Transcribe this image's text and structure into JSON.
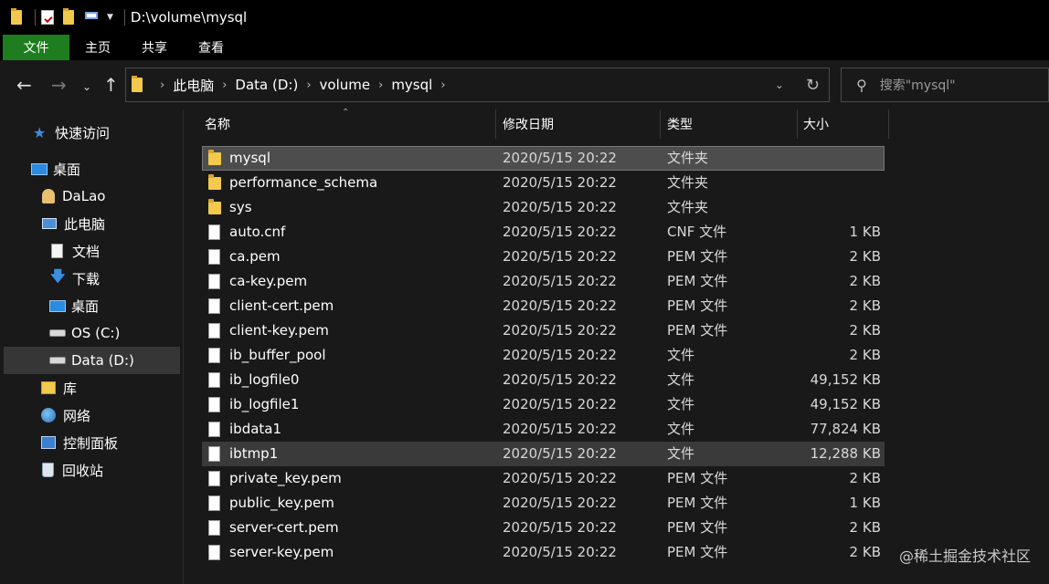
{
  "window": {
    "title": "D:\\volume\\mysql"
  },
  "ribbon": {
    "tabs": [
      {
        "label": "文件",
        "active": true
      },
      {
        "label": "主页",
        "active": false
      },
      {
        "label": "共享",
        "active": false
      },
      {
        "label": "查看",
        "active": false
      }
    ]
  },
  "nav": {
    "back_icon": "back-arrow",
    "forward_icon": "forward-arrow",
    "recent_icon": "chevron-down",
    "up_icon": "up-arrow"
  },
  "address": {
    "crumbs": [
      "此电脑",
      "Data (D:)",
      "volume",
      "mysql"
    ]
  },
  "search": {
    "placeholder": "搜索\"mysql\""
  },
  "sidebar": {
    "items": [
      {
        "label": "快速访问",
        "icon": "star-icon"
      },
      {
        "label": "桌面",
        "icon": "desktop-icon"
      },
      {
        "label": "DaLao",
        "icon": "user-folder-icon"
      },
      {
        "label": "此电脑",
        "icon": "computer-icon"
      },
      {
        "label": "文档",
        "icon": "document-icon"
      },
      {
        "label": "下载",
        "icon": "download-icon"
      },
      {
        "label": "桌面",
        "icon": "desktop-icon"
      },
      {
        "label": "OS (C:)",
        "icon": "drive-icon"
      },
      {
        "label": "Data (D:)",
        "icon": "drive-icon",
        "selected": true
      },
      {
        "label": "库",
        "icon": "library-icon"
      },
      {
        "label": "网络",
        "icon": "network-icon"
      },
      {
        "label": "控制面板",
        "icon": "control-panel-icon"
      },
      {
        "label": "回收站",
        "icon": "recycle-bin-icon"
      }
    ]
  },
  "columns": {
    "name": "名称",
    "date": "修改日期",
    "type": "类型",
    "size": "大小"
  },
  "files": [
    {
      "name": "mysql",
      "date": "2020/5/15 20:22",
      "type": "文件夹",
      "size": "",
      "kind": "folder",
      "state": "selected"
    },
    {
      "name": "performance_schema",
      "date": "2020/5/15 20:22",
      "type": "文件夹",
      "size": "",
      "kind": "folder"
    },
    {
      "name": "sys",
      "date": "2020/5/15 20:22",
      "type": "文件夹",
      "size": "",
      "kind": "folder"
    },
    {
      "name": "auto.cnf",
      "date": "2020/5/15 20:22",
      "type": "CNF 文件",
      "size": "1 KB",
      "kind": "file"
    },
    {
      "name": "ca.pem",
      "date": "2020/5/15 20:22",
      "type": "PEM 文件",
      "size": "2 KB",
      "kind": "file"
    },
    {
      "name": "ca-key.pem",
      "date": "2020/5/15 20:22",
      "type": "PEM 文件",
      "size": "2 KB",
      "kind": "file"
    },
    {
      "name": "client-cert.pem",
      "date": "2020/5/15 20:22",
      "type": "PEM 文件",
      "size": "2 KB",
      "kind": "file"
    },
    {
      "name": "client-key.pem",
      "date": "2020/5/15 20:22",
      "type": "PEM 文件",
      "size": "2 KB",
      "kind": "file"
    },
    {
      "name": "ib_buffer_pool",
      "date": "2020/5/15 20:22",
      "type": "文件",
      "size": "2 KB",
      "kind": "file"
    },
    {
      "name": "ib_logfile0",
      "date": "2020/5/15 20:22",
      "type": "文件",
      "size": "49,152 KB",
      "kind": "file"
    },
    {
      "name": "ib_logfile1",
      "date": "2020/5/15 20:22",
      "type": "文件",
      "size": "49,152 KB",
      "kind": "file"
    },
    {
      "name": "ibdata1",
      "date": "2020/5/15 20:22",
      "type": "文件",
      "size": "77,824 KB",
      "kind": "file"
    },
    {
      "name": "ibtmp1",
      "date": "2020/5/15 20:22",
      "type": "文件",
      "size": "12,288 KB",
      "kind": "file",
      "state": "hover"
    },
    {
      "name": "private_key.pem",
      "date": "2020/5/15 20:22",
      "type": "PEM 文件",
      "size": "2 KB",
      "kind": "file"
    },
    {
      "name": "public_key.pem",
      "date": "2020/5/15 20:22",
      "type": "PEM 文件",
      "size": "1 KB",
      "kind": "file"
    },
    {
      "name": "server-cert.pem",
      "date": "2020/5/15 20:22",
      "type": "PEM 文件",
      "size": "2 KB",
      "kind": "file"
    },
    {
      "name": "server-key.pem",
      "date": "2020/5/15 20:22",
      "type": "PEM 文件",
      "size": "2 KB",
      "kind": "file"
    }
  ],
  "watermark": "@稀土掘金技术社区",
  "colors": {
    "ribbon_active": "#1e7d1e",
    "background": "#191919",
    "selection": "#4d4d4d"
  }
}
